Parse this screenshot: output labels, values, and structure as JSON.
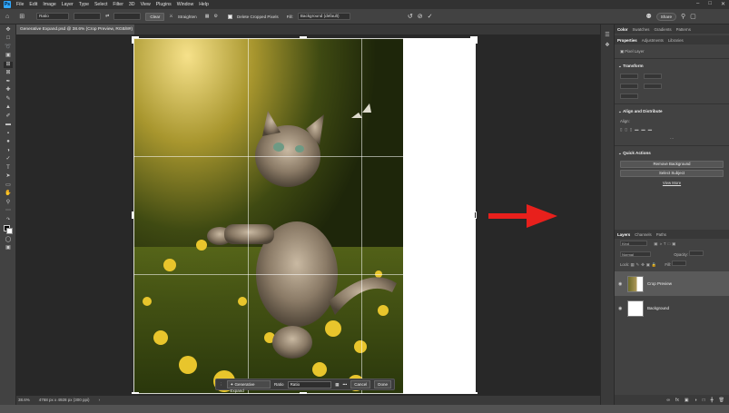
{
  "menubar": {
    "logo": "Ps",
    "items": [
      "File",
      "Edit",
      "Image",
      "Layer",
      "Type",
      "Select",
      "Filter",
      "3D",
      "View",
      "Plugins",
      "Window",
      "Help"
    ]
  },
  "options": {
    "ratio_label": "Ratio",
    "clear_label": "Clear",
    "straighten_label": "Straighten",
    "delete_cropped_label": "Delete Cropped Pixels",
    "fill_label": "Fill:",
    "fill_value": "Background (default)",
    "share_label": "Share"
  },
  "document": {
    "tab_title": "Generative Expand.psd @ 38.6% (Crop Preview, RGB/8#)"
  },
  "context_bar": {
    "generative_expand_label": "Generative Expand",
    "ratio_label": "Ratio",
    "ratio_value": "Ratio",
    "more_label": "•••",
    "cancel_label": "Cancel",
    "done_label": "Done"
  },
  "status": {
    "zoom": "38.6%",
    "dims": "4768 px x 4928 px (300 ppi)"
  },
  "panels": {
    "top_tabs": [
      "Color",
      "Swatches",
      "Gradients",
      "Patterns"
    ],
    "prop_tabs": [
      "Properties",
      "Adjustments",
      "Libraries"
    ],
    "pixel_layer": "Pixel Layer",
    "transform_title": "Transform",
    "align_title": "Align and Distribute",
    "align_label": "Align:",
    "quick_actions_title": "Quick Actions",
    "remove_bg": "Remove Background",
    "select_subject": "Select Subject",
    "view_more": "View More",
    "layer_tabs": [
      "Layers",
      "Channels",
      "Paths"
    ],
    "kind_placeholder": "Kind",
    "blend_mode": "Normal",
    "opacity_label": "Opacity:",
    "lock_label": "Lock:",
    "fill_label": "Fill:",
    "layers": [
      {
        "name": "Crop Preview",
        "selected": true
      },
      {
        "name": "Background",
        "selected": false
      }
    ]
  },
  "colors": {
    "accent": "#31a8ff",
    "arrow": "#e8201c"
  }
}
